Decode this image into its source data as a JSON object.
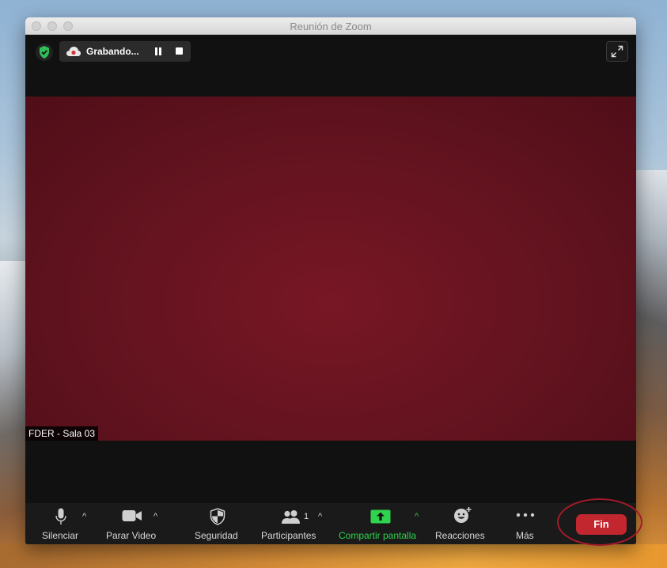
{
  "window": {
    "title": "Reunión de Zoom"
  },
  "recording": {
    "label": "Grabando..."
  },
  "video": {
    "participant_name": "FDER - Sala 03"
  },
  "toolbar": {
    "mute_label": "Silenciar",
    "video_label": "Parar Video",
    "security_label": "Seguridad",
    "participants_label": "Participantes",
    "participants_count": "1",
    "share_label": "Compartir pantalla",
    "reactions_label": "Reacciones",
    "more_label": "Más",
    "end_label": "Fin"
  },
  "colors": {
    "share_green": "#2fd34e",
    "end_red": "#c2262e",
    "video_bg": "#6b1420",
    "security_green": "#2fbf57"
  },
  "icons": [
    "shield-check-icon",
    "cloud-record-icon",
    "pause-icon",
    "stop-icon",
    "fullscreen-icon",
    "microphone-icon",
    "video-camera-icon",
    "shield-icon",
    "participants-icon",
    "share-screen-icon",
    "reactions-icon",
    "more-icon",
    "caret-up-icon"
  ]
}
